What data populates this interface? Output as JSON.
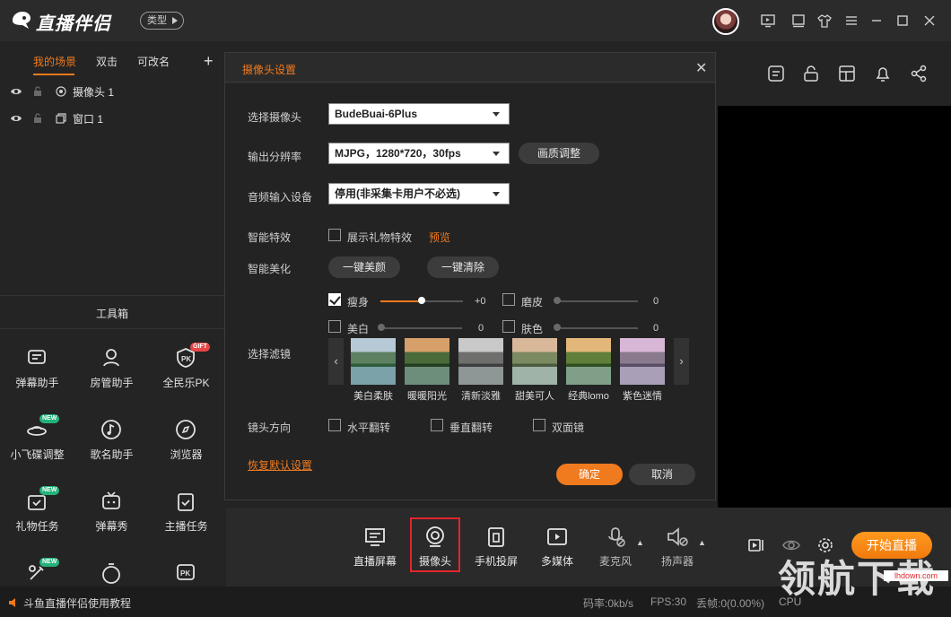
{
  "app": {
    "title": "直播伴侣",
    "type_button": "类型"
  },
  "scenes": {
    "tabs": [
      "我的场景",
      "双击",
      "可改名"
    ],
    "add_label": "+",
    "sources": [
      "摄像头 1",
      "窗口 1"
    ]
  },
  "toolbox": {
    "title": "工具箱",
    "tools": [
      {
        "label": "弹幕助手",
        "icon": "bullet-chat-icon"
      },
      {
        "label": "房管助手",
        "icon": "admin-icon"
      },
      {
        "label": "全民乐PK",
        "icon": "pk-icon",
        "badge": "GIFT"
      },
      {
        "label": "小飞碟调整",
        "icon": "ufo-icon",
        "badge": "NEW"
      },
      {
        "label": "歌名助手",
        "icon": "music-icon"
      },
      {
        "label": "浏览器",
        "icon": "compass-icon"
      },
      {
        "label": "礼物任务",
        "icon": "gift-task-icon",
        "badge": "NEW"
      },
      {
        "label": "弹幕秀",
        "icon": "tv-icon"
      },
      {
        "label": "主播任务",
        "icon": "task-icon"
      },
      {
        "label": "",
        "icon": "tool-icon",
        "badge": "NEW"
      },
      {
        "label": "",
        "icon": "timer-icon"
      },
      {
        "label": "",
        "icon": "pk-box-icon"
      }
    ]
  },
  "dialog": {
    "title": "摄像头设置",
    "rows": {
      "camera_label": "选择摄像头",
      "camera_value": "BudeBuai-6Plus",
      "resolution_label": "输出分辨率",
      "resolution_value": "MJPG，1280*720，30fps",
      "quality_button": "画质调整",
      "audio_label": "音频输入设备",
      "audio_value": "停用(非采集卡用户不必选)",
      "effects_label": "智能特效",
      "effects_option": "展示礼物特效",
      "effects_preview": "预览",
      "beauty_label": "智能美化",
      "beauty_button": "一键美颜",
      "clear_button": "一键清除",
      "filter_label": "选择滤镜",
      "mirror_label": "镜头方向",
      "restore_link": "恢复默认设置"
    },
    "sliders": [
      {
        "label": "瘦身",
        "checked": true,
        "value_text": "+0",
        "level": 0.52
      },
      {
        "label": "磨皮",
        "checked": false,
        "value_text": "0",
        "level": 0.0
      },
      {
        "label": "美白",
        "checked": false,
        "value_text": "0",
        "level": 0.0
      },
      {
        "label": "肤色",
        "checked": false,
        "value_text": "0",
        "level": 0.0
      }
    ],
    "filters": [
      "美白柔肤",
      "暖暖阳光",
      "清新淡雅",
      "甜美可人",
      "经典lomo",
      "紫色迷情"
    ],
    "mirror_options": [
      "水平翻转",
      "垂直翻转",
      "双面镜"
    ],
    "ok": "确定",
    "cancel": "取消"
  },
  "bottom_bar": {
    "items": [
      {
        "label": "直播屏幕",
        "icon": "screen-icon"
      },
      {
        "label": "摄像头",
        "icon": "camera-icon"
      },
      {
        "label": "手机投屏",
        "icon": "phone-cast-icon"
      },
      {
        "label": "多媒体",
        "icon": "media-icon"
      },
      {
        "label": "麦克风",
        "icon": "mic-muted-icon"
      },
      {
        "label": "扬声器",
        "icon": "speaker-muted-icon"
      }
    ],
    "start_button": "开始直播"
  },
  "status": {
    "tutorial": "斗鱼直播伴侣使用教程",
    "bitrate": "码率:0kb/s",
    "fps": "FPS:30",
    "dropped": "丢帧:0(0.00%)",
    "cpu": "CPU"
  },
  "watermark": {
    "text": "领航下载",
    "domain": "lhdown.com"
  },
  "colors": {
    "accent": "#f07a1e",
    "highlight_box": "#e3262c",
    "badge_new": "#23b37a",
    "badge_gift": "#e84545"
  }
}
